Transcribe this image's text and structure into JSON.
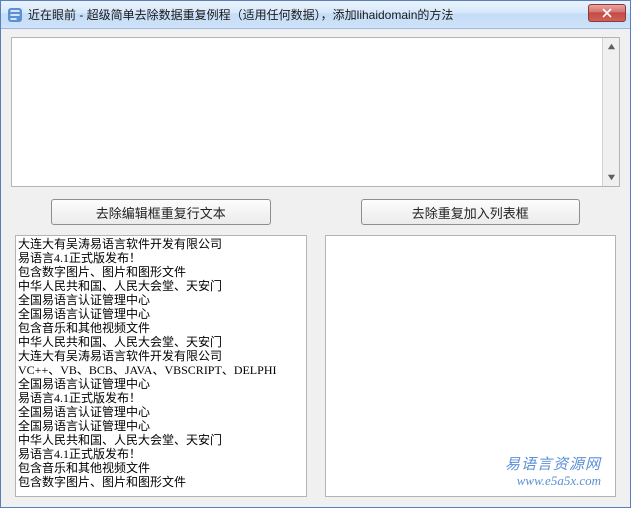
{
  "window": {
    "title": "近在眼前 - 超级简单去除数据重复例程（适用任何数据），添加lihaidomain的方法",
    "close_label": "X"
  },
  "editor": {
    "content": ""
  },
  "buttons": {
    "dedupe_edit": "去除编辑框重复行文本",
    "dedupe_list": "去除重复加入列表框"
  },
  "list_left": [
    "大连大有吴涛易语言软件开发有限公司",
    "易语言4.1正式版发布！",
    "包含数字图片、图片和图形文件",
    "中华人民共和国、人民大会堂、天安门",
    "全国易语言认证管理中心",
    "全国易语言认证管理中心",
    "包含音乐和其他视频文件",
    "中华人民共和国、人民大会堂、天安门",
    "大连大有吴涛易语言软件开发有限公司",
    "VC++、VB、BCB、JAVA、VBSCRIPT、DELPHI",
    "全国易语言认证管理中心",
    "易语言4.1正式版发布！",
    "全国易语言认证管理中心",
    "全国易语言认证管理中心",
    "中华人民共和国、人民大会堂、天安门",
    "易语言4.1正式版发布！",
    "包含音乐和其他视频文件",
    "包含数字图片、图片和图形文件"
  ],
  "list_right": [],
  "watermark": {
    "line1": "易语言资源网",
    "line2": "www.e5a5x.com"
  }
}
